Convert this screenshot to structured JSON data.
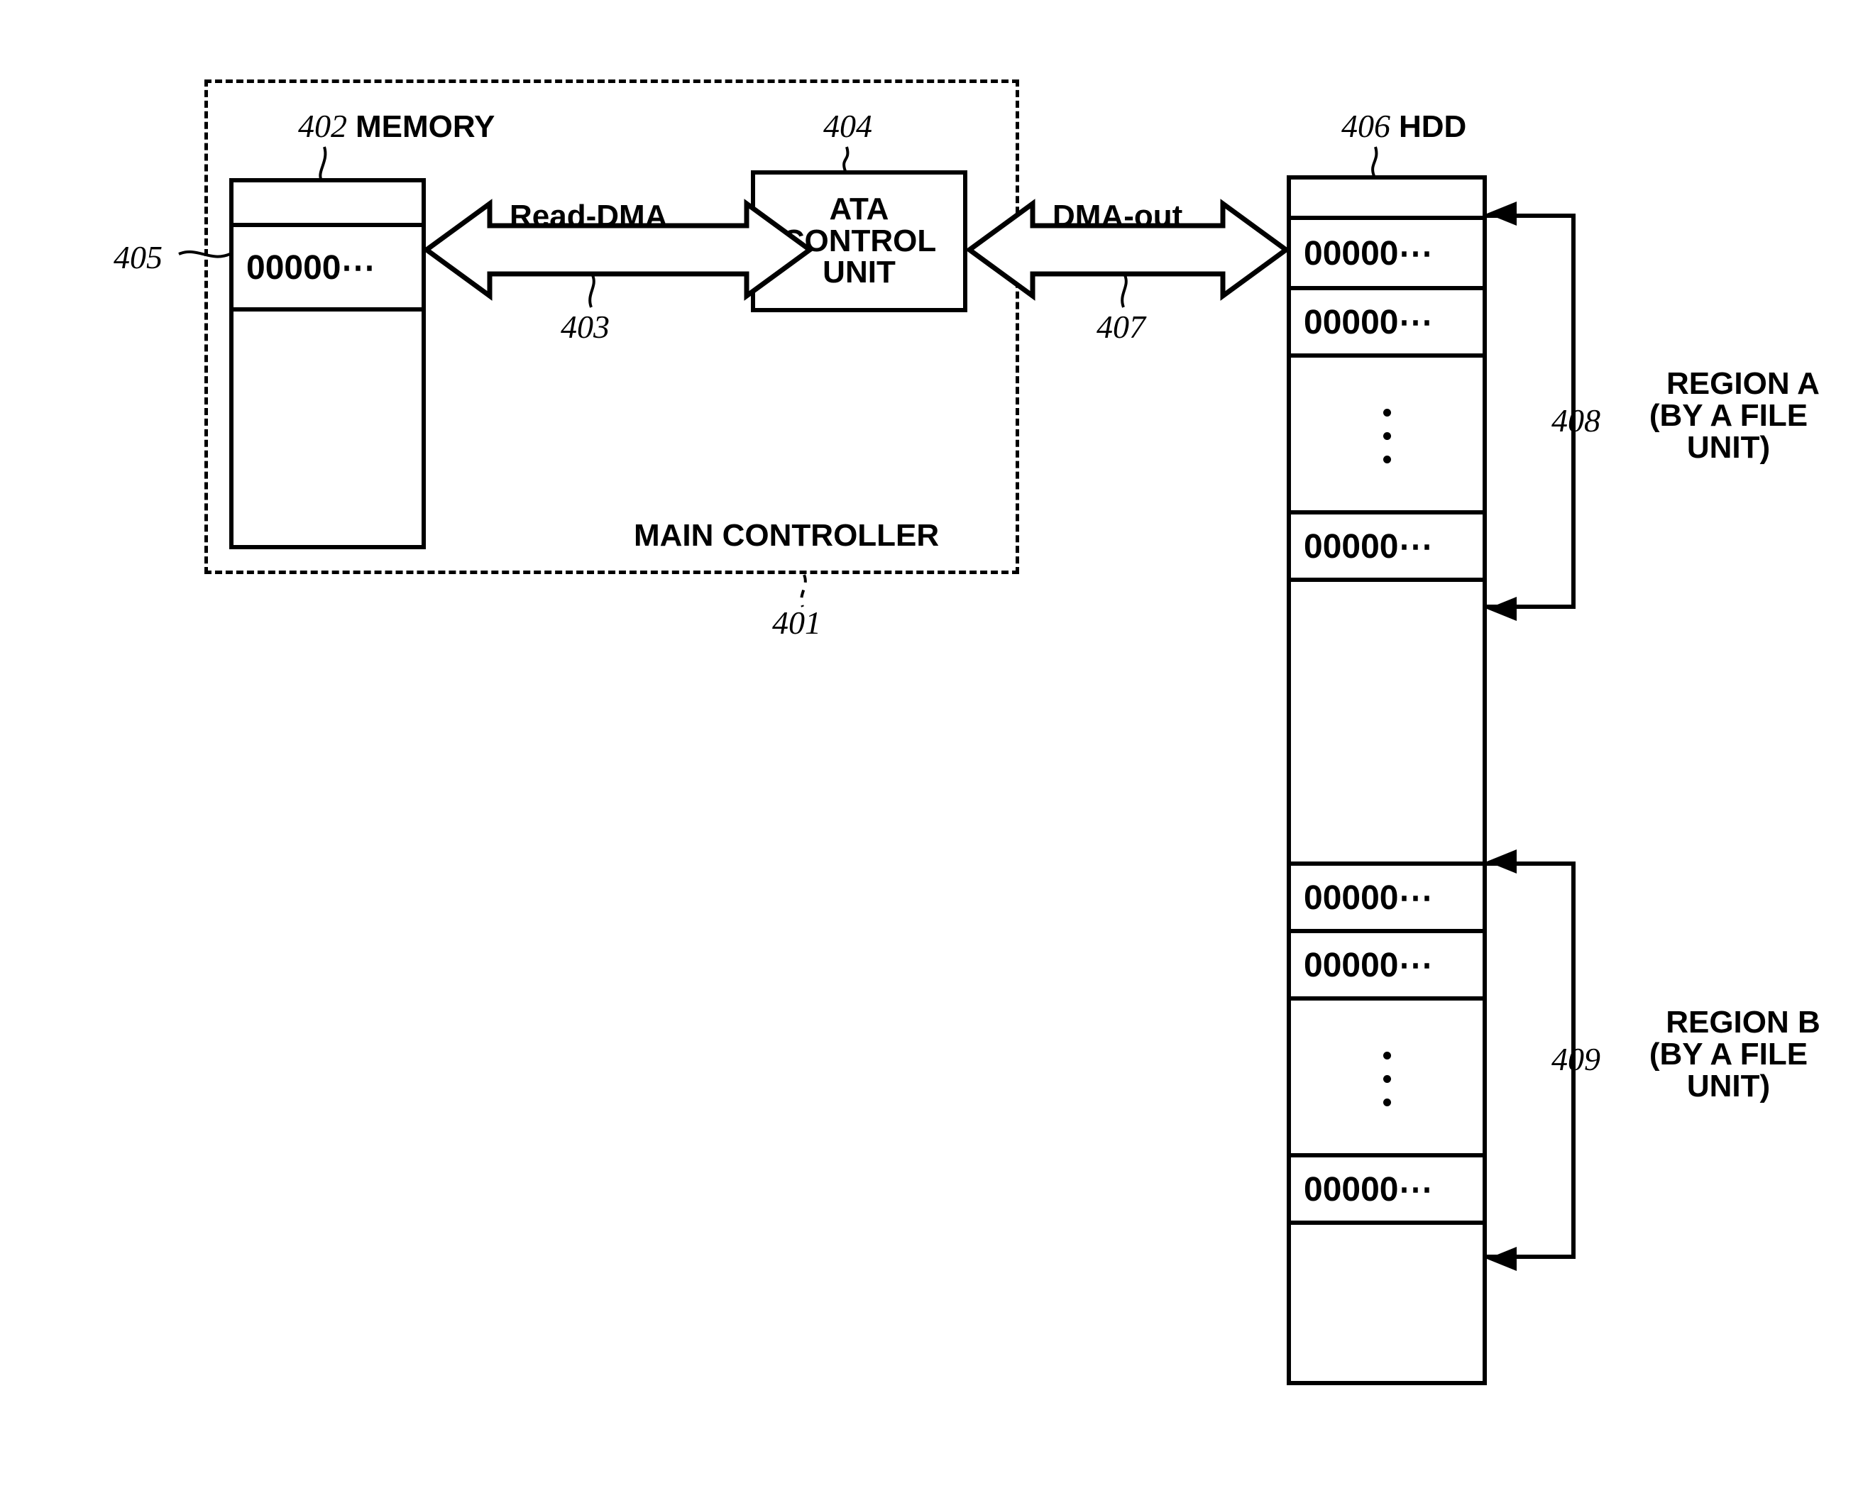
{
  "figure": {
    "main_controller_label": "MAIN CONTROLLER",
    "main_controller_ref": "401"
  },
  "memory": {
    "ref": "402",
    "title": "MEMORY",
    "buffer_ref": "405",
    "rows": [
      {
        "text": ""
      },
      {
        "text": "00000⋯"
      },
      {
        "text": ""
      }
    ]
  },
  "bus_left": {
    "label": "Read-DMA",
    "ref": "403"
  },
  "ata": {
    "ref": "404",
    "line1": "ATA",
    "line2": "CONTROL",
    "line3": "UNIT"
  },
  "bus_right": {
    "label": "DMA-out",
    "ref": "407"
  },
  "hdd": {
    "ref": "406",
    "title": "HDD",
    "rows": [
      {
        "text": "",
        "kind": "blank"
      },
      {
        "text": "00000⋯",
        "kind": "data"
      },
      {
        "text": "00000⋯",
        "kind": "data"
      },
      {
        "text": "",
        "kind": "dots"
      },
      {
        "text": "00000⋯",
        "kind": "data"
      },
      {
        "text": "",
        "kind": "blank"
      },
      {
        "text": "00000⋯",
        "kind": "data"
      },
      {
        "text": "00000⋯",
        "kind": "data"
      },
      {
        "text": "",
        "kind": "dots"
      },
      {
        "text": "00000⋯",
        "kind": "data"
      },
      {
        "text": "",
        "kind": "blank"
      }
    ]
  },
  "regions": [
    {
      "ref": "408",
      "name": "REGION A",
      "detail_line1": "(BY A FILE",
      "detail_line2": "UNIT)"
    },
    {
      "ref": "409",
      "name": "REGION B",
      "detail_line1": "(BY A FILE",
      "detail_line2": "UNIT)"
    }
  ],
  "colors": {
    "ink": "#000000",
    "paper": "#ffffff"
  }
}
